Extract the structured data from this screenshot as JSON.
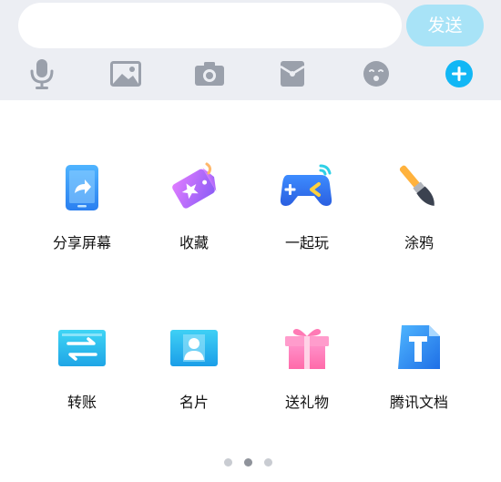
{
  "composer": {
    "input_value": "",
    "input_placeholder": "",
    "send_label": "发送"
  },
  "toolbar": {
    "icons": [
      "microphone-icon",
      "image-icon",
      "camera-icon",
      "red-packet-icon",
      "emoji-icon",
      "plus-icon"
    ],
    "icon_color": "#9aa0ab",
    "plus_color": "#12b7f5"
  },
  "panel": {
    "items": [
      {
        "label": "分享屏幕",
        "icon": "share-screen-icon"
      },
      {
        "label": "收藏",
        "icon": "favorites-icon"
      },
      {
        "label": "一起玩",
        "icon": "gamepad-icon"
      },
      {
        "label": "涂鸦",
        "icon": "paintbrush-icon"
      },
      {
        "label": "转账",
        "icon": "transfer-icon"
      },
      {
        "label": "名片",
        "icon": "contact-card-icon"
      },
      {
        "label": "送礼物",
        "icon": "gift-icon"
      },
      {
        "label": "腾讯文档",
        "icon": "tencent-docs-icon"
      }
    ]
  },
  "pager": {
    "pages": 3,
    "active_page": 2
  },
  "colors": {
    "toolbar_bg": "#eceef3",
    "send_button_bg": "#a8e3f7"
  }
}
